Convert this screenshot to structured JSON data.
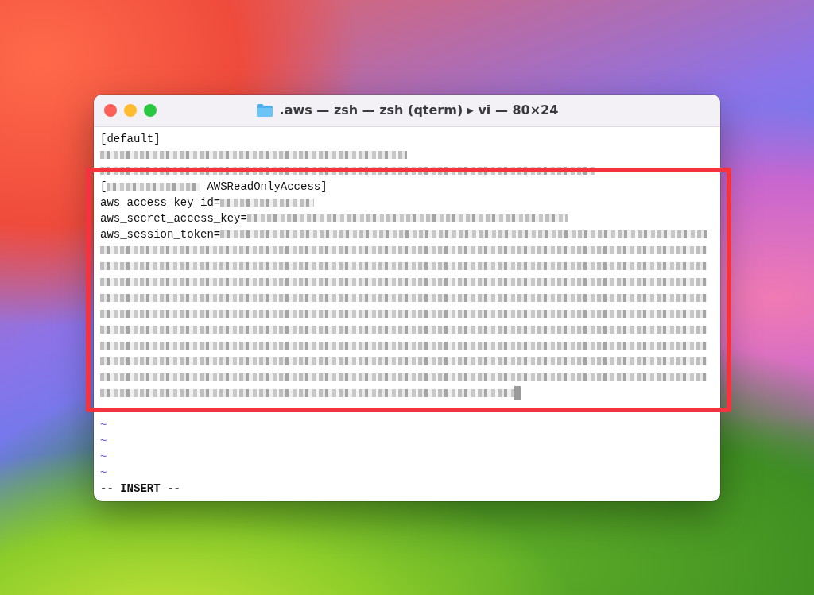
{
  "window": {
    "title": ".aws — zsh — zsh (qterm) ▸ vi — 80×24"
  },
  "editor": {
    "lines": [
      {
        "segments": [
          {
            "kind": "text",
            "text": "[default]"
          }
        ]
      },
      {
        "segments": [
          {
            "kind": "redacted"
          }
        ]
      },
      {
        "segments": [
          {
            "kind": "redacted"
          }
        ]
      },
      {
        "segments": [
          {
            "kind": "text",
            "text": "["
          },
          {
            "kind": "redacted"
          },
          {
            "kind": "text",
            "text": "_AWSReadOnlyAccess]"
          }
        ]
      },
      {
        "segments": [
          {
            "kind": "text",
            "text": "aws_access_key_id="
          },
          {
            "kind": "redacted"
          }
        ]
      },
      {
        "segments": [
          {
            "kind": "text",
            "text": "aws_secret_access_key="
          },
          {
            "kind": "redacted"
          }
        ]
      },
      {
        "segments": [
          {
            "kind": "text",
            "text": "aws_session_token="
          },
          {
            "kind": "redacted"
          }
        ]
      },
      {
        "segments": [
          {
            "kind": "redacted"
          }
        ]
      },
      {
        "segments": [
          {
            "kind": "redacted"
          }
        ]
      },
      {
        "segments": [
          {
            "kind": "redacted"
          }
        ]
      },
      {
        "segments": [
          {
            "kind": "redacted"
          }
        ]
      },
      {
        "segments": [
          {
            "kind": "redacted"
          }
        ]
      },
      {
        "segments": [
          {
            "kind": "redacted"
          }
        ]
      },
      {
        "segments": [
          {
            "kind": "redacted"
          }
        ]
      },
      {
        "segments": [
          {
            "kind": "redacted"
          }
        ]
      },
      {
        "segments": [
          {
            "kind": "redacted"
          }
        ]
      },
      {
        "segments": [
          {
            "kind": "redacted"
          },
          {
            "kind": "cursor"
          }
        ]
      },
      {
        "segments": [
          {
            "kind": "tilde",
            "text": "~"
          }
        ]
      },
      {
        "segments": [
          {
            "kind": "tilde",
            "text": "~"
          }
        ]
      },
      {
        "segments": [
          {
            "kind": "tilde",
            "text": "~"
          }
        ]
      },
      {
        "segments": [
          {
            "kind": "tilde",
            "text": "~"
          }
        ]
      }
    ],
    "mode": "-- INSERT --"
  }
}
